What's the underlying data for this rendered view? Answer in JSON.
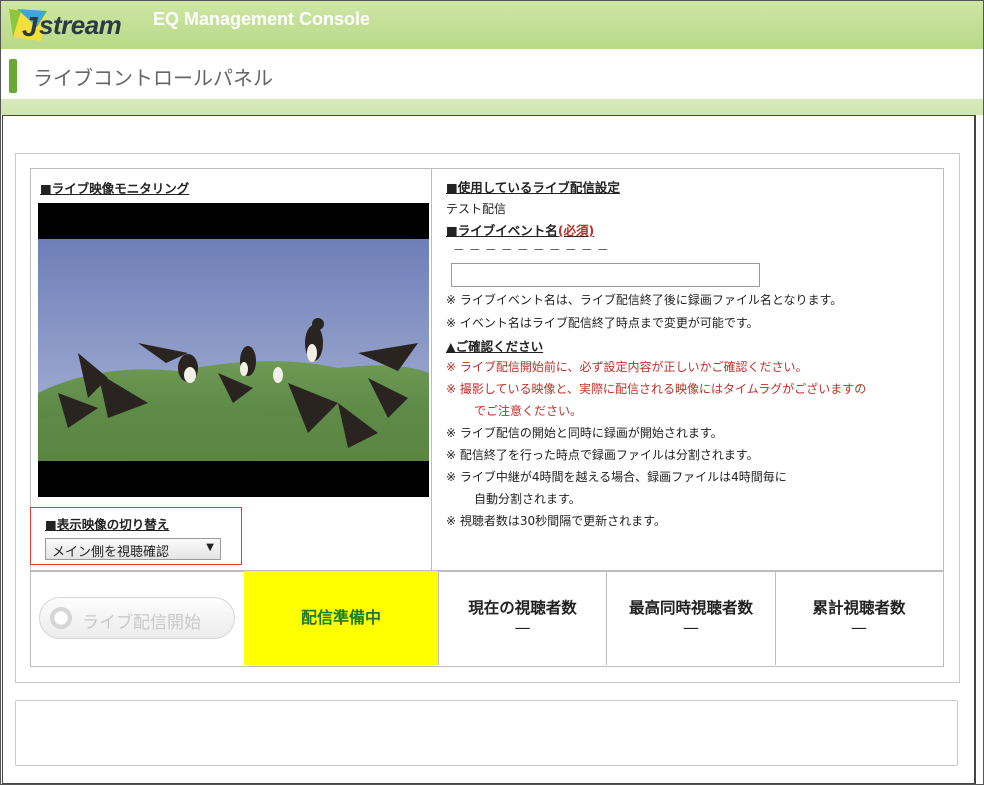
{
  "header": {
    "logo_text": "stream",
    "console_title": "EQ Management Console"
  },
  "page": {
    "title": "ライブコントロールパネル"
  },
  "left": {
    "monitor_heading": "■ライブ映像モニタリング",
    "switch_heading": "■表示映像の切り替え",
    "switch_value": "メイン側を視聴確認"
  },
  "right": {
    "setting_heading": "■使用しているライブ配信設定",
    "setting_value": "テスト配信",
    "event_name_heading": "■ライブイベント名",
    "required_label": "(必須)",
    "event_name_current": "－－－－－－－－－－",
    "event_name_value": "",
    "notes_1": [
      "※ ライブイベント名は、ライブ配信終了後に録画ファイル名となります。",
      "※ イベント名はライブ配信終了時点まで変更が可能です。"
    ],
    "confirm_heading": "▲ご確認ください",
    "warn_1": "※ ライブ配信開始前に、必ず設定内容が正しいかご確認ください。",
    "warn_2a": "※ 撮影している映像と、実際に配信される映像にはタイムラグがございますの",
    "warn_2b": "でご注意ください。",
    "note_3": "※ ライブ配信の開始と同時に録画が開始されます。",
    "note_4": "※ 配信終了を行った時点で録画ファイルは分割されます。",
    "note_5a": "※ ライブ中継が4時間を越える場合、録画ファイルは4時間毎に",
    "note_5b": "自動分割されます。",
    "note_6": "※ 視聴者数は30秒間隔で更新されます。"
  },
  "status": {
    "start_button": "ライブ配信開始",
    "state": "配信準備中",
    "current_viewers_label": "現在の視聴者数",
    "current_viewers_value": "—",
    "peak_viewers_label": "最高同時視聴者数",
    "peak_viewers_value": "—",
    "total_viewers_label": "累計視聴者数",
    "total_viewers_value": "—",
    "state_color": "#ffff00"
  },
  "colors": {
    "brand_green": "#6aa832",
    "warning_red": "#c0302a",
    "highlight_border": "#e23a3a"
  }
}
